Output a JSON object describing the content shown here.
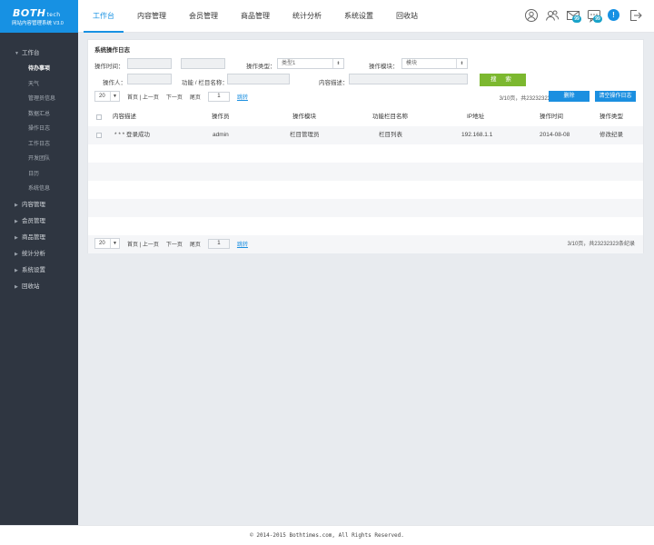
{
  "logo": {
    "brand": "BOTH",
    "brand_suffix": "tech",
    "subtitle": "网站内容管理系统 V3.0"
  },
  "topnav": [
    {
      "label": "工作台",
      "active": true
    },
    {
      "label": "内容管理",
      "active": false
    },
    {
      "label": "会员管理",
      "active": false
    },
    {
      "label": "商品管理",
      "active": false
    },
    {
      "label": "统计分析",
      "active": false
    },
    {
      "label": "系统设置",
      "active": false
    },
    {
      "label": "回收站",
      "active": false
    }
  ],
  "toolbar": {
    "mail_badge": "99",
    "chat_badge": "99",
    "info_glyph": "!"
  },
  "sidebar": {
    "groups": [
      {
        "label": "工作台",
        "expanded": true,
        "items": [
          "待办事项",
          "天气",
          "管理员信息",
          "数据汇总",
          "操作日志",
          "工作日志",
          "开发团队",
          "日历",
          "系统信息"
        ]
      },
      {
        "label": "内容管理"
      },
      {
        "label": "会员管理"
      },
      {
        "label": "商品管理"
      },
      {
        "label": "统计分析"
      },
      {
        "label": "系统设置"
      },
      {
        "label": "回收站"
      }
    ],
    "active_item": "待办事项"
  },
  "panel": {
    "title": "系统操作日志",
    "filters": {
      "op_time_label": "操作时间：",
      "op_type_label": "操作类型：",
      "op_type_value": "类型1",
      "op_module_label": "操作模块：",
      "op_module_value": "模块",
      "operator_label": "操作人：",
      "function_label": "功能 / 栏目名称：",
      "content_label": "内容描述："
    },
    "search_label": "搜 索",
    "delete_label": "删除",
    "clear_label": "清空操作日志",
    "pager": {
      "page_size": "20",
      "first_prev": "首页 | 上一页",
      "next": "下一页",
      "last": "尾页",
      "page_input": "1",
      "jump": "跳转",
      "info": "3/10页，共23232323条纪录",
      "info_bottom": "3/10页，共23232323条纪录"
    },
    "table": {
      "headers": [
        "内容描述",
        "操作员",
        "操作模块",
        "功能栏目名称",
        "IP地址",
        "操作时间",
        "操作类型"
      ],
      "rows": [
        [
          "* * * 登录成功",
          "admin",
          "栏目管理员",
          "栏目列表",
          "192.168.1.1",
          "2014-08-08",
          "修改纪录"
        ]
      ]
    }
  },
  "footer": {
    "text": "© 2014-2015 Bothtimes.com, All Rights Reserved."
  },
  "colors": {
    "accent": "#1791e3",
    "sidebar_bg": "#2f3641",
    "search_green": "#7cb82f",
    "badge": "#19a3c9"
  }
}
